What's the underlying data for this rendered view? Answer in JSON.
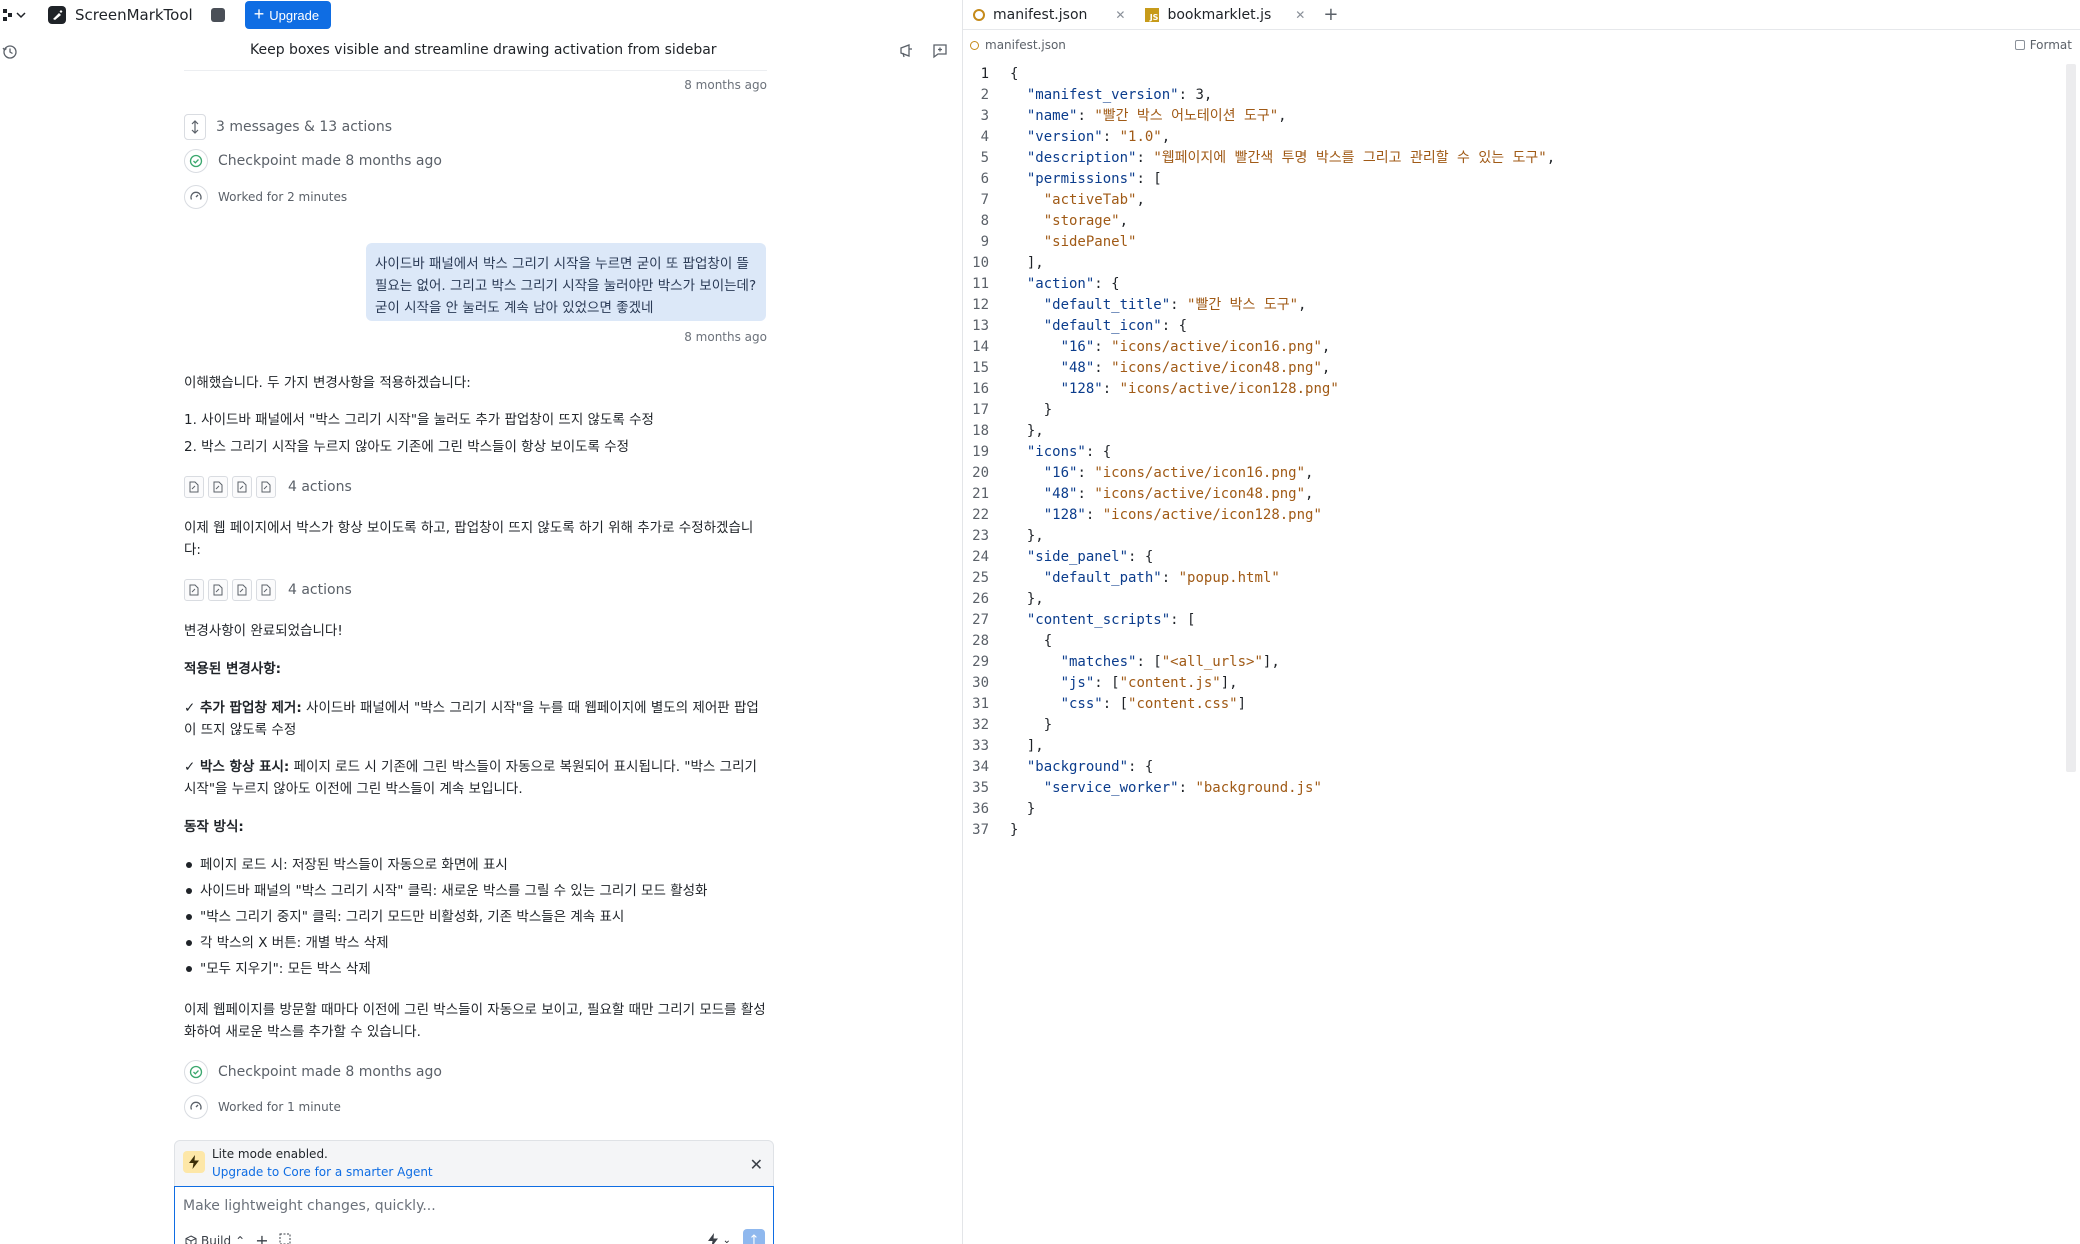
{
  "topbar": {
    "project_name": "ScreenMarkTool",
    "upgrade_label": "Upgrade"
  },
  "chat": {
    "title": "Keep boxes visible and streamline drawing activation from sidebar",
    "ts1": "8 months ago",
    "summary_messages": "3 messages & 13 actions",
    "checkpoint1": "Checkpoint made 8 months ago",
    "worked1": "Worked for 2 minutes",
    "user_message": "사이드바 패널에서 박스 그리기 시작을 누르면 굳이 또 팝업창이 뜰 필요는 없어. 그리고 박스 그리기 시작을 눌러야만 박스가 보이는데? 굳이 시작을 안 눌러도 계속 남아 있었으면 좋겠네",
    "ts2": "8 months ago",
    "ai_intro": "이해했습니다. 두 가지 변경사항을 적용하겠습니다:",
    "ai_item1": "1. 사이드바 패널에서 \"박스 그리기 시작\"을 눌러도 추가 팝업창이 뜨지 않도록 수정",
    "ai_item2": "2. 박스 그리기 시작을 누르지 않아도 기존에 그린 박스들이 항상 보이도록 수정",
    "actions1": "4 actions",
    "ai_para2": "이제 웹 페이지에서 박스가 항상 보이도록 하고, 팝업창이 뜨지 않도록 하기 위해 추가로 수정하겠습니다:",
    "actions2": "4 actions",
    "done": "변경사항이 완료되었습니다!",
    "applied_heading": "적용된 변경사항:",
    "change1_bold": "✓ 추가 팝업창 제거:",
    "change1_text": " 사이드바 패널에서 \"박스 그리기 시작\"을 누를 때 웹페이지에 별도의 제어판 팝업이 뜨지 않도록 수정",
    "change2_bold": "✓ 박스 항상 표시:",
    "change2_text": " 페이지 로드 시 기존에 그린 박스들이 자동으로 복원되어 표시됩니다. \"박스 그리기 시작\"을 누르지 않아도 이전에 그린 박스들이 계속 보입니다.",
    "behavior_heading": "동작 방식:",
    "bullets": [
      "페이지 로드 시: 저장된 박스들이 자동으로 화면에 표시",
      "사이드바 패널의 \"박스 그리기 시작\" 클릭: 새로운 박스를 그릴 수 있는 그리기 모드 활성화",
      "\"박스 그리기 중지\" 클릭: 그리기 모드만 비활성화, 기존 박스들은 계속 표시",
      "각 박스의 X 버튼: 개별 박스 삭제",
      "\"모두 지우기\": 모든 박스 삭제"
    ],
    "final_para": "이제 웹페이지를 방문할 때마다 이전에 그린 박스들이 자동으로 보이고, 필요할 때만 그리기 모드를 활성화하여 새로운 박스를 추가할 수 있습니다.",
    "checkpoint2": "Checkpoint made 8 months ago",
    "worked2": "Worked for 1 minute"
  },
  "lite": {
    "title": "Lite mode enabled.",
    "link": "Upgrade to Core for a smarter Agent"
  },
  "input": {
    "placeholder": "Make lightweight changes, quickly...",
    "build_label": "Build"
  },
  "editor": {
    "tabs": [
      {
        "label": "manifest.json"
      },
      {
        "label": "bookmarklet.js"
      }
    ],
    "breadcrumb": "manifest.json",
    "format_label": "Format",
    "lines": [
      "{",
      "  \"manifest_version\": 3,",
      "  \"name\": \"빨간 박스 어노테이션 도구\",",
      "  \"version\": \"1.0\",",
      "  \"description\": \"웹페이지에 빨간색 투명 박스를 그리고 관리할 수 있는 도구\",",
      "  \"permissions\": [",
      "    \"activeTab\",",
      "    \"storage\",",
      "    \"sidePanel\"",
      "  ],",
      "  \"action\": {",
      "    \"default_title\": \"빨간 박스 도구\",",
      "    \"default_icon\": {",
      "      \"16\": \"icons/active/icon16.png\",",
      "      \"48\": \"icons/active/icon48.png\",",
      "      \"128\": \"icons/active/icon128.png\"",
      "    }",
      "  },",
      "  \"icons\": {",
      "    \"16\": \"icons/active/icon16.png\",",
      "    \"48\": \"icons/active/icon48.png\",",
      "    \"128\": \"icons/active/icon128.png\"",
      "  },",
      "  \"side_panel\": {",
      "    \"default_path\": \"popup.html\"",
      "  },",
      "  \"content_scripts\": [",
      "    {",
      "      \"matches\": [\"<all_urls>\"],",
      "      \"js\": [\"content.js\"],",
      "      \"css\": [\"content.css\"]",
      "    }",
      "  ],",
      "  \"background\": {",
      "    \"service_worker\": \"background.js\"",
      "  }",
      "}"
    ]
  },
  "colors": {
    "accent": "#0f6de3",
    "user_bubble": "#dce8f8",
    "json_key": "#0b3c8c",
    "json_string": "#a05a16"
  }
}
